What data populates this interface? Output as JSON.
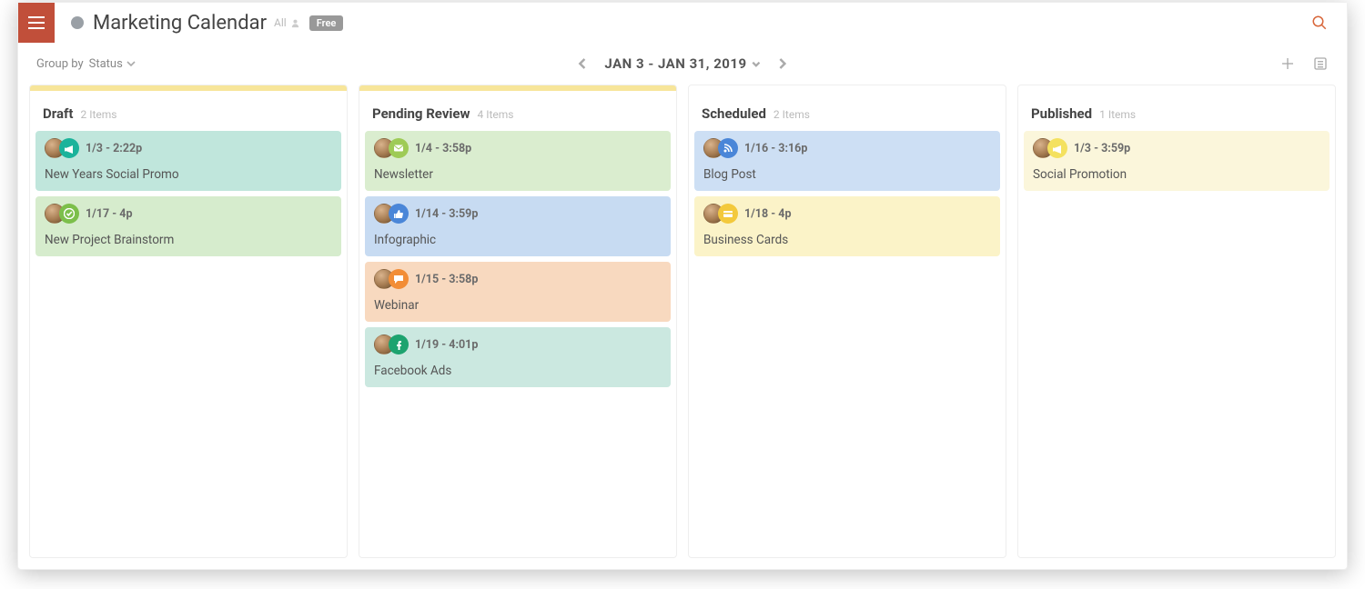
{
  "header": {
    "title": "Marketing Calendar",
    "meta": "All",
    "badge": "Free"
  },
  "toolbar": {
    "groupby_label": "Group by",
    "groupby_value": "Status",
    "date_range": "JAN 3 - JAN 31, 2019"
  },
  "columns": [
    {
      "title": "Draft",
      "count": "2 Items",
      "accent": "yellow",
      "cards": [
        {
          "bg": "bg-teal",
          "chip": "chip-teal",
          "icon": "megaphone",
          "time": "1/3 - 2:22p",
          "title": "New Years Social Promo"
        },
        {
          "bg": "bg-green",
          "chip": "chip-green",
          "icon": "check",
          "time": "1/17 - 4p",
          "title": "New Project Brainstorm"
        }
      ]
    },
    {
      "title": "Pending Review",
      "count": "4 Items",
      "accent": "yellow",
      "cards": [
        {
          "bg": "bg-lgreen",
          "chip": "chip-lime",
          "icon": "mail",
          "time": "1/4 - 3:58p",
          "title": "Newsletter"
        },
        {
          "bg": "bg-blue",
          "chip": "chip-blue",
          "icon": "thumb",
          "time": "1/14 - 3:59p",
          "title": "Infographic"
        },
        {
          "bg": "bg-orange",
          "chip": "chip-orange",
          "icon": "chat",
          "time": "1/15 - 3:58p",
          "title": "Webinar"
        },
        {
          "bg": "bg-mint",
          "chip": "chip-fb",
          "icon": "fb",
          "time": "1/19 - 4:01p",
          "title": "Facebook Ads"
        }
      ]
    },
    {
      "title": "Scheduled",
      "count": "2 Items",
      "accent": "none",
      "cards": [
        {
          "bg": "bg-lblue",
          "chip": "chip-rss",
          "icon": "rss",
          "time": "1/16 - 3:16p",
          "title": "Blog Post"
        },
        {
          "bg": "bg-yellow",
          "chip": "chip-yellow",
          "icon": "card",
          "time": "1/18 - 4p",
          "title": "Business Cards"
        }
      ]
    },
    {
      "title": "Published",
      "count": "1 Items",
      "accent": "none",
      "cards": [
        {
          "bg": "bg-paleyellow",
          "chip": "chip-paleyellow",
          "icon": "megaphone",
          "time": "1/3 - 3:59p",
          "title": "Social Promotion"
        }
      ]
    }
  ]
}
